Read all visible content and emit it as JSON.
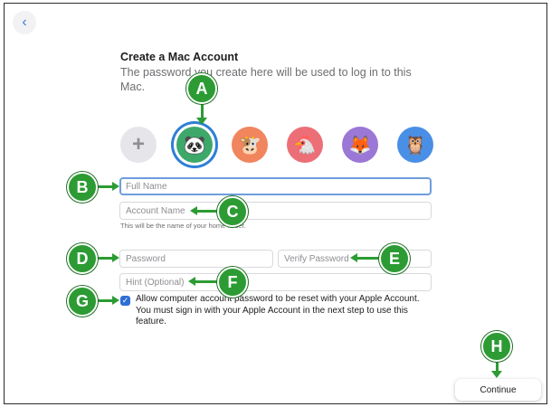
{
  "header": {
    "back_icon": "chevron-left-icon",
    "title": "Create a Mac Account",
    "subtitle": "The password you create here will be used to log in to this Mac."
  },
  "avatars": [
    {
      "name": "add-photo",
      "icon": "plus-icon",
      "glyph": "+"
    },
    {
      "name": "panda",
      "icon": "panda-icon",
      "glyph": "🐼",
      "bg": "#3da86a",
      "selected": true
    },
    {
      "name": "cow",
      "icon": "cow-icon",
      "glyph": "🐮",
      "bg": "#f0855e"
    },
    {
      "name": "chicken",
      "icon": "chicken-icon",
      "glyph": "🐔",
      "bg": "#ec6f78"
    },
    {
      "name": "fox",
      "icon": "fox-icon",
      "glyph": "🦊",
      "bg": "#9b77d6"
    },
    {
      "name": "owl",
      "icon": "owl-icon",
      "glyph": "🦉",
      "bg": "#4a8fe6"
    }
  ],
  "form": {
    "full_name_placeholder": "Full Name",
    "account_name_placeholder": "Account Name",
    "account_name_hint": "This will be the name of your home folder.",
    "password_placeholder": "Password",
    "verify_password_placeholder": "Verify Password",
    "hint_placeholder": "Hint (Optional)",
    "reset_checkbox_label": "Allow computer account password to be reset with your Apple Account. You must sign in with your Apple Account in the next step to use this feature.",
    "reset_checkbox_checked": true
  },
  "footer": {
    "continue_label": "Continue"
  },
  "callouts": {
    "a": "A",
    "b": "B",
    "c": "C",
    "d": "D",
    "e": "E",
    "f": "F",
    "g": "G",
    "h": "H"
  },
  "colors": {
    "accent": "#2e7fd6",
    "callout": "#2c9b33"
  }
}
